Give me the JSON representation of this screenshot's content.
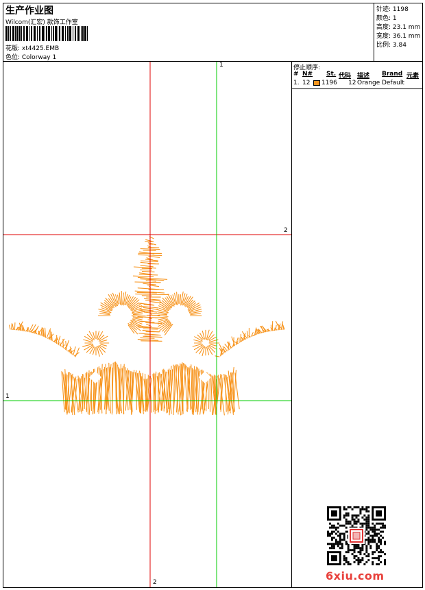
{
  "header": {
    "title": "生产作业图",
    "subtitle": "Wilcom(汇宏) 款饰工作室",
    "design_label": "花版: xt4425.EMB",
    "colorway_label": "色位: Colorway 1"
  },
  "stats": {
    "stitches": "针迹: 1198",
    "colors": "颜色: 1",
    "height": "高度: 23.1 mm",
    "width": "宽度: 36.1 mm",
    "scale": "比例: 3.84"
  },
  "sidebar": {
    "title": "停止顺序:",
    "columns": [
      "#",
      "N#",
      "St.",
      "代码",
      "描述",
      "Brand",
      "元素"
    ],
    "rows": [
      {
        "index": "1.",
        "needle": "12",
        "stitches": "1196",
        "code": "12",
        "description": "Orange",
        "brand": "Default",
        "swatch_color": "#f7941d"
      }
    ]
  },
  "guides": {
    "v_red_label": "2",
    "h_red_label": "2",
    "v_green_label": "1",
    "h_green_label": "1"
  },
  "watermark": "6xiu.com",
  "colors": {
    "thread": "#f7941d",
    "red_guide": "#e00000",
    "green_guide": "#00cc00"
  }
}
